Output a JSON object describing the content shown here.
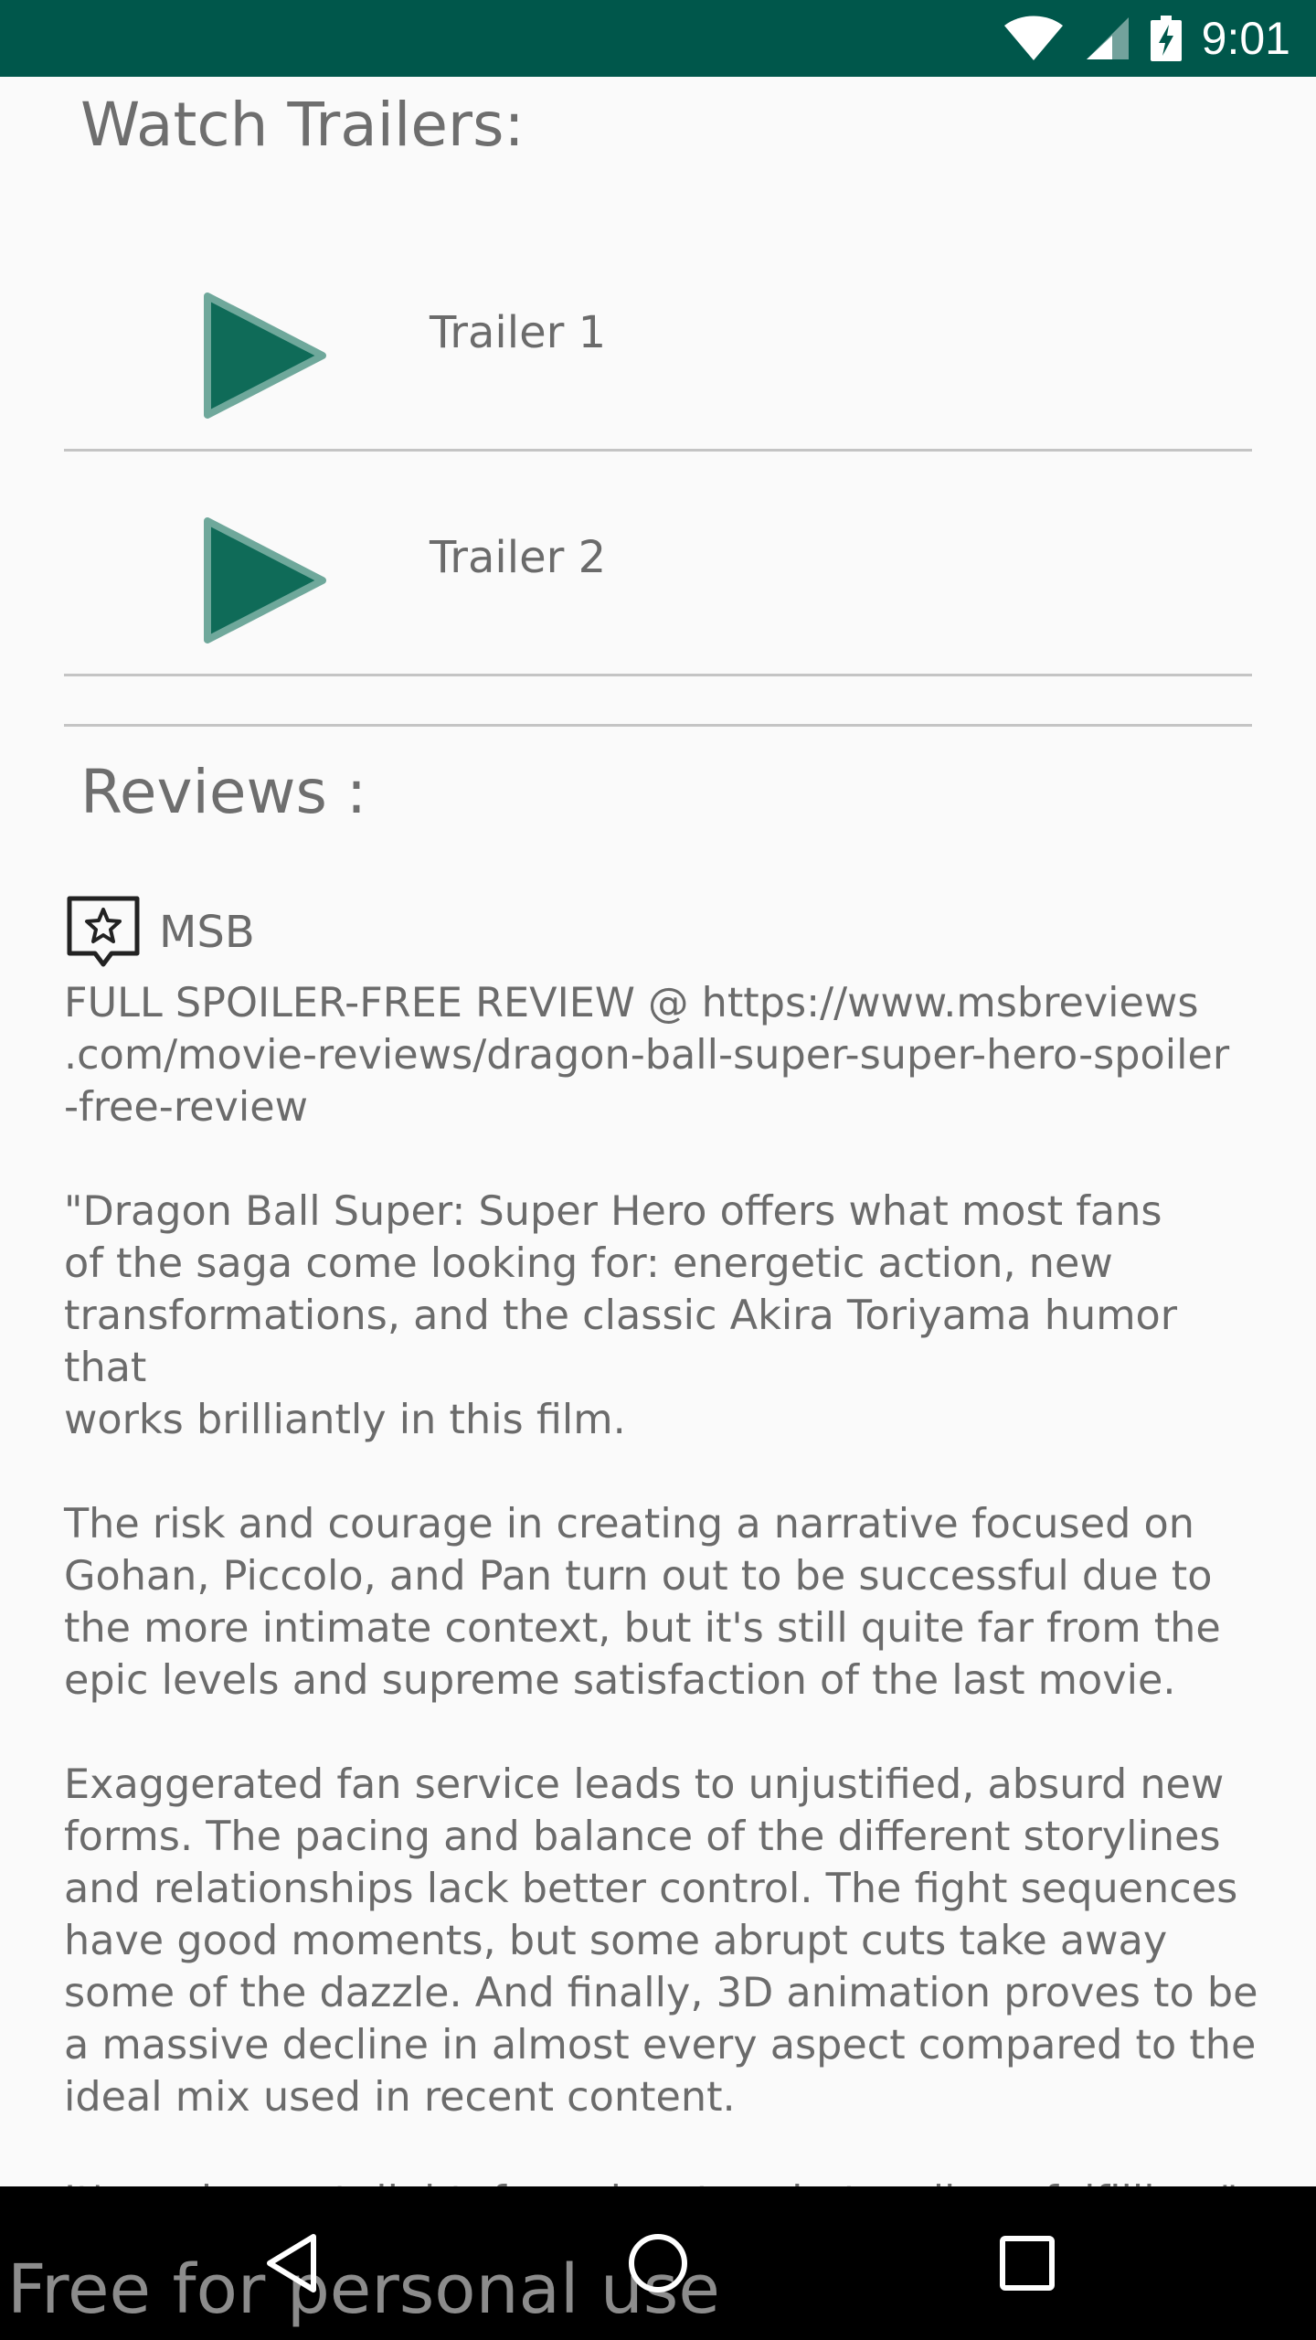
{
  "status_bar": {
    "time": "9:01",
    "icons": [
      "wifi-icon",
      "cell-signal-icon",
      "battery-charging-icon"
    ],
    "background": "#00574b"
  },
  "trailers": {
    "title": "Watch Trailers:",
    "items": [
      {
        "label": "Trailer 1",
        "icon": "play-icon"
      },
      {
        "label": "Trailer 2",
        "icon": "play-icon"
      }
    ],
    "icon_color": "#0f6b58"
  },
  "reviews": {
    "title": "Reviews :",
    "items": [
      {
        "author": "MSB",
        "author_icon": "review-star-icon",
        "content": "FULL SPOILER-FREE REVIEW @ https://www.msbreviews\n.com/movie-reviews/dragon-ball-super-super-hero-spoiler\n-free-review\n\n\"Dragon Ball Super: Super Hero offers what most fans\nof the saga come looking for: energetic action, new\ntransformations, and the classic Akira Toriyama humor that\nworks brilliantly in this film.\n\nThe risk and courage in creating a narrative focused on\nGohan, Piccolo, and Pan turn out to be successful due to\nthe more intimate context, but it's still quite far from the\nepic levels and supreme satisfaction of the last movie.\n\nExaggerated fan service leads to unjustified, absurd new\nforms. The pacing and balance of the different storylines\nand relationships lack better control. The fight sequences\nhave good moments, but some abrupt cuts take away\nsome of the dazzle. And finally, 3D animation proves to be\na massive decline in almost every aspect compared to the\nideal mix used in recent content.\n\nIt's a pleasant, light, fun adventure but sadly unfulfilling.\""
      }
    ]
  },
  "nav_bar": {
    "buttons": [
      "back-icon",
      "home-icon",
      "recents-icon"
    ]
  },
  "watermark": "Free for personal use"
}
